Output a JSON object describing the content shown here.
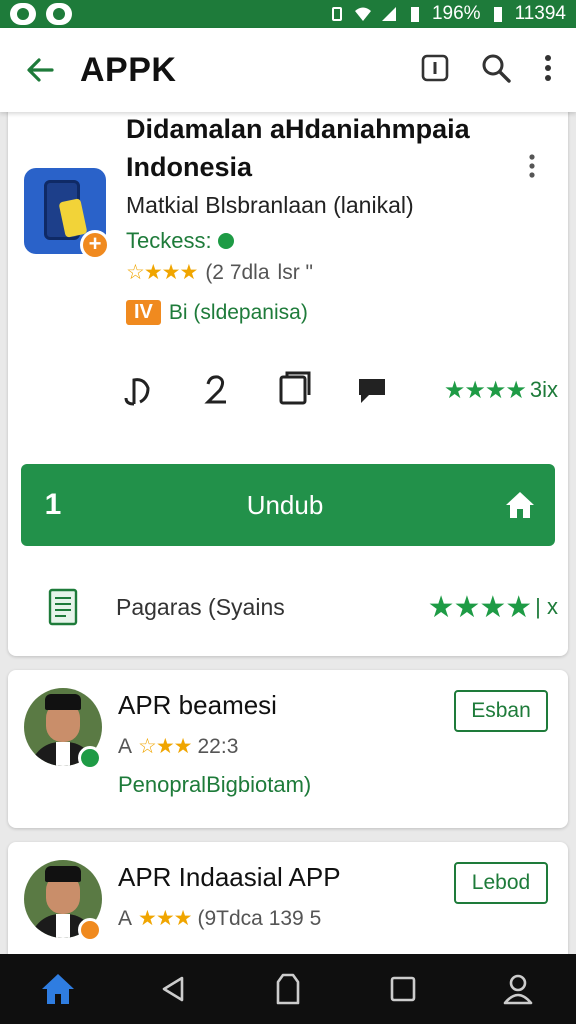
{
  "status_bar": {
    "battery": "196%",
    "time": "11394"
  },
  "app_bar": {
    "title": "APPK"
  },
  "app_card": {
    "title_line1": "Didamalan aHdaniahmpaia",
    "title_line2": "Indonesia",
    "developer": "Matkial Blsbranlaan (lanikal)",
    "tag": "Teckess:",
    "rating_stars": "☆★★★",
    "rating_text": "(2 7dla",
    "rating_extra": "lsr \"",
    "badge_label": "IV",
    "badge_text": "Bi (sldepanisa)",
    "stats_rating_text": "3ix",
    "stats_stars": "★★★★",
    "download": {
      "number": "1",
      "label": "Undub"
    },
    "pages_label": "Pagaras (Syains",
    "pages_stars": "★★★★",
    "pages_suffix": "| x"
  },
  "list_items": [
    {
      "title": "APR beamesi",
      "rating_prefix": "A",
      "stars": "☆★★",
      "rating_text": "22:3",
      "subtitle": "PenopralBigbiotam)",
      "button": "Esban",
      "badge_color": "#1e9b45"
    },
    {
      "title": "APR Indaasial APP",
      "rating_prefix": "A",
      "stars": "★★★",
      "rating_text": "(9Tdca 139 5",
      "subtitle": "",
      "button": "Lebod",
      "badge_color": "#f08a1f"
    }
  ],
  "colors": {
    "primary": "#1e7b3a",
    "download": "#22914a",
    "star": "#f0a500",
    "nav_active": "#2f7de1"
  }
}
